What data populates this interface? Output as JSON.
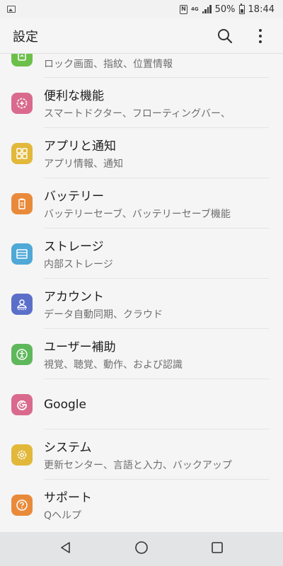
{
  "status_bar": {
    "lte_label": "4G",
    "battery_percent": "50%",
    "time": "18:44"
  },
  "app_bar": {
    "title": "設定",
    "icons": [
      "search-icon",
      "more-vert-icon"
    ]
  },
  "items": [
    {
      "title": "",
      "subtitle": "ロック画面、指紋、位置情報",
      "icon": "lock-screen-icon",
      "color": "#6cc04a"
    },
    {
      "title": "便利な機能",
      "subtitle": "スマートドクター、フローティングバー、",
      "icon": "gear-plus-icon",
      "color": "#d96a8e"
    },
    {
      "title": "アプリと通知",
      "subtitle": "アプリ情報、通知",
      "icon": "apps-grid-icon",
      "color": "#e2b83a"
    },
    {
      "title": "バッテリー",
      "subtitle": "バッテリーセーブ、バッテリーセーブ機能",
      "icon": "battery-icon",
      "color": "#e98a3b"
    },
    {
      "title": "ストレージ",
      "subtitle": "内部ストレージ",
      "icon": "storage-icon",
      "color": "#4fa8d6"
    },
    {
      "title": "アカウント",
      "subtitle": "データ自動同期、クラウド",
      "icon": "account-icon",
      "color": "#5b6fc9"
    },
    {
      "title": "ユーザー補助",
      "subtitle": "視覚、聴覚、動作、および認識",
      "icon": "accessibility-icon",
      "color": "#5eb85b"
    },
    {
      "title": "Google",
      "subtitle": "",
      "icon": "google-icon",
      "color": "#d96a8e"
    },
    {
      "title": "システム",
      "subtitle": "更新センター、言語と入力、バックアップ",
      "icon": "system-gear-icon",
      "color": "#e2b83a"
    },
    {
      "title": "サポート",
      "subtitle": "Qヘルプ",
      "icon": "help-icon",
      "color": "#e98a3b"
    }
  ],
  "nav_bar": {
    "icons": [
      "back-icon",
      "home-icon",
      "recents-icon"
    ]
  }
}
